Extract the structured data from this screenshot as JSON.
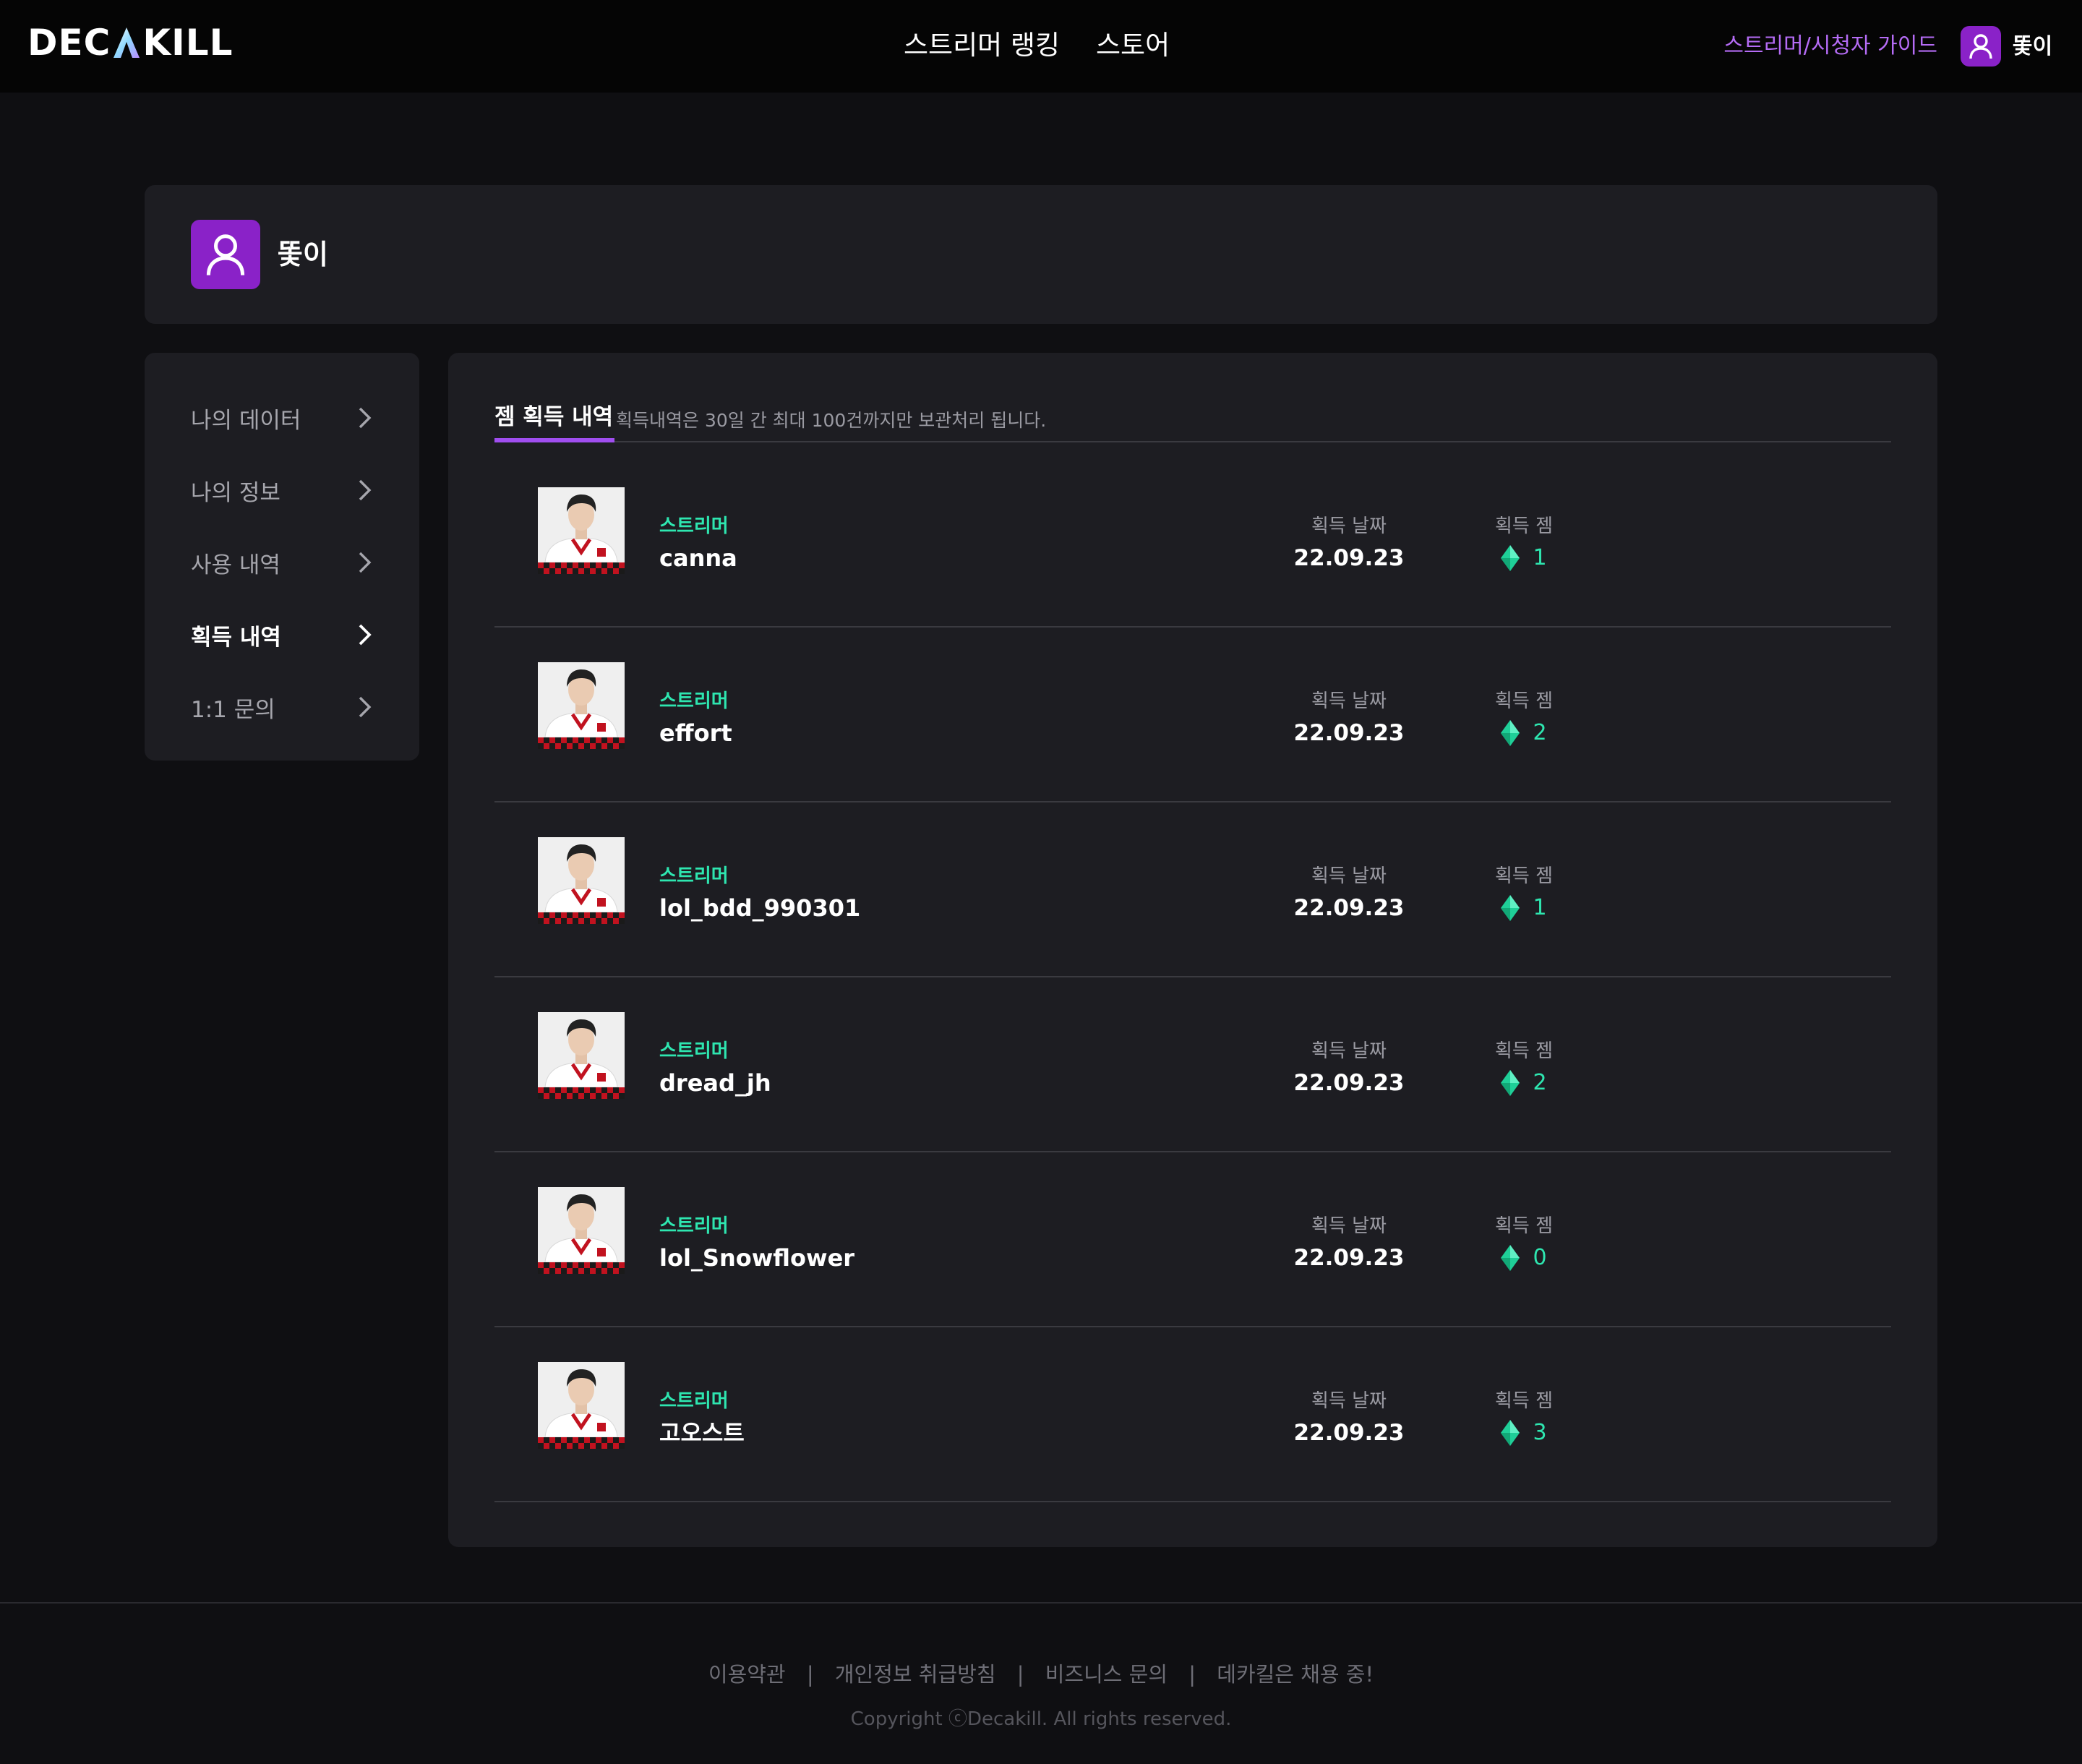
{
  "brand": {
    "logo_text_left": "DEC",
    "logo_text_right": "KILL",
    "accent": "#8a22c8",
    "gem_color": "#2ee6b0"
  },
  "header": {
    "nav": [
      {
        "label": "스트리머 랭킹"
      },
      {
        "label": "스토어"
      }
    ],
    "guide_link": "스트리머/시청자 가이드",
    "username": "똧이",
    "avatar_icon": "user-icon"
  },
  "profile": {
    "username": "똧이",
    "avatar_icon": "user-icon"
  },
  "sidebar": {
    "items": [
      {
        "label": "나의 데이터",
        "active": false
      },
      {
        "label": "나의 정보",
        "active": false
      },
      {
        "label": "사용 내역",
        "active": false
      },
      {
        "label": "획득 내역",
        "active": true
      },
      {
        "label": "1:1 문의",
        "active": false
      }
    ]
  },
  "main": {
    "tab_label": "젬 획득 내역",
    "tab_note": "획득내역은 30일 간 최대 100건까지만 보관처리 됩니다.",
    "rows": [
      {
        "tag": "스트리머",
        "name": "canna",
        "date_label": "획득 날짜",
        "date": "22.09.23",
        "gem_label": "획득 젬",
        "gems": "1"
      },
      {
        "tag": "스트리머",
        "name": "effort",
        "date_label": "획득 날짜",
        "date": "22.09.23",
        "gem_label": "획득 젬",
        "gems": "2"
      },
      {
        "tag": "스트리머",
        "name": "lol_bdd_990301",
        "date_label": "획득 날짜",
        "date": "22.09.23",
        "gem_label": "획득 젬",
        "gems": "1"
      },
      {
        "tag": "스트리머",
        "name": "dread_jh",
        "date_label": "획득 날짜",
        "date": "22.09.23",
        "gem_label": "획득 젬",
        "gems": "2"
      },
      {
        "tag": "스트리머",
        "name": "lol_Snowflower",
        "date_label": "획득 날짜",
        "date": "22.09.23",
        "gem_label": "획득 젬",
        "gems": "0"
      },
      {
        "tag": "스트리머",
        "name": "고오스트",
        "date_label": "획득 날짜",
        "date": "22.09.23",
        "gem_label": "획득 젬",
        "gems": "3"
      }
    ]
  },
  "footer": {
    "links": [
      "이용약관",
      "개인정보 취급방침",
      "비즈니스 문의",
      "데카킬은 채용 중!"
    ],
    "separator": "|",
    "copyright": "Copyright ⓒDecakill. All rights reserved."
  }
}
